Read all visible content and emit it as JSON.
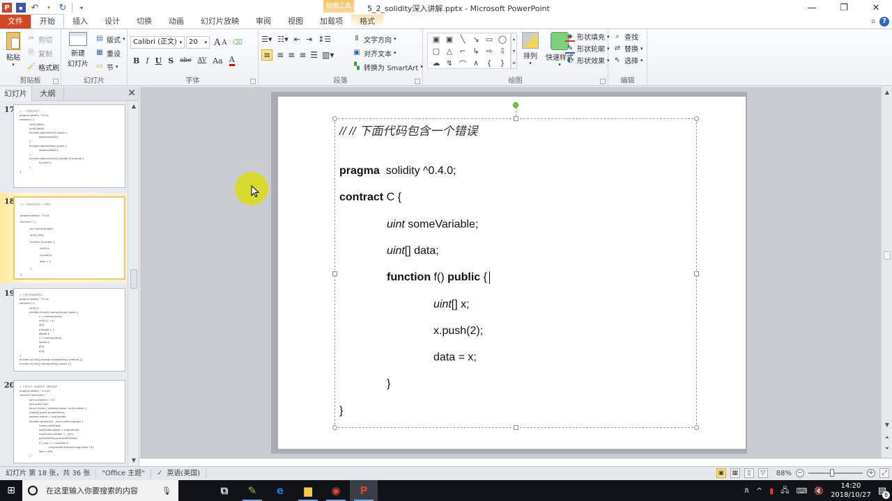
{
  "window": {
    "title": "5_2_solidity深入讲解.pptx - Microsoft PowerPoint",
    "context_tab_group": "绘图工具",
    "controls": {
      "minimize": "—",
      "restore": "❐",
      "close": "✕"
    }
  },
  "quick_access": {
    "app_icon": "P",
    "save_icon": "💾",
    "undo_icon": "↶",
    "redo_icon": "↻",
    "customize_icon": "▾"
  },
  "tabs": [
    {
      "label": "文件",
      "type": "file"
    },
    {
      "label": "开始",
      "type": "active"
    },
    {
      "label": "插入",
      "type": ""
    },
    {
      "label": "设计",
      "type": ""
    },
    {
      "label": "切换",
      "type": ""
    },
    {
      "label": "动画",
      "type": ""
    },
    {
      "label": "幻灯片放映",
      "type": ""
    },
    {
      "label": "审阅",
      "type": ""
    },
    {
      "label": "视图",
      "type": ""
    },
    {
      "label": "加载项",
      "type": ""
    },
    {
      "label": "格式",
      "type": "context"
    }
  ],
  "ribbon": {
    "clipboard": {
      "label": "剪贴板",
      "paste": "粘贴",
      "cut": "剪切",
      "copy": "复制",
      "format_painter": "格式刷"
    },
    "slides": {
      "label": "幻灯片",
      "new_slide_line1": "新建",
      "new_slide_line2": "幻灯片",
      "layout": "版式",
      "reset": "重设",
      "section": "节"
    },
    "font": {
      "label": "字体",
      "font_name": "Calibri (正文)",
      "font_size": "20",
      "grow": "A",
      "shrink": "A",
      "bold": "B",
      "italic": "I",
      "underline": "U",
      "shadow": "S",
      "strikethrough": "abe",
      "spacing": "AV",
      "case": "Aa",
      "color": "A",
      "font_color_hex": "#d00000"
    },
    "paragraph": {
      "label": "段落",
      "text_direction": "文字方向",
      "align_text": "对齐文本",
      "convert_smartart": "转换为 SmartArt"
    },
    "drawing": {
      "label": "绘图",
      "arrange": "排列",
      "quick_styles": "快速样式",
      "shape_fill": "形状填充",
      "shape_outline": "形状轮廓",
      "shape_effects": "形状效果",
      "shapes": [
        "▣",
        "▣",
        "╲",
        "↘",
        "▭",
        "◯",
        "▢",
        "△",
        "⌐",
        "↳",
        "⇨",
        "⇩",
        "☁",
        "↯",
        "⌒",
        "∧",
        "{",
        "}"
      ]
    },
    "editing": {
      "label": "编辑",
      "find": "查找",
      "replace": "替换",
      "select": "选择"
    }
  },
  "left_pane": {
    "tabs": [
      "幻灯片",
      "大纲"
    ],
    "close_icon": "✕",
    "thumbnails": [
      {
        "number": "17",
        "selected": false,
        "lines": [
          {
            "t": "// 一个简单的例子",
            "c": true
          },
          {
            "t": "pragma solidity ^0.4.0;",
            "i": 0
          },
          {
            "t": "contract C {",
            "i": 0
          },
          {
            "t": "uint[] data1;",
            "i": 1
          },
          {
            "t": "uint[] data2;",
            "i": 1
          },
          {
            "t": "function appendOne() public {",
            "i": 1
          },
          {
            "t": "append(data1);",
            "i": 2
          },
          {
            "t": "}",
            "i": 1
          },
          {
            "t": "function appendTwo() public {",
            "i": 1
          },
          {
            "t": "append(data2);",
            "i": 2
          },
          {
            "t": "}",
            "i": 1
          },
          {
            "t": "function append(uint[] storage d) internal {",
            "i": 1
          },
          {
            "t": "d.push(1);",
            "i": 2
          },
          {
            "t": "}",
            "i": 1
          },
          {
            "t": "}",
            "i": 0
          }
        ]
      },
      {
        "number": "18",
        "selected": true,
        "lines": [
          {
            "t": "// // 下面代码包含一个错误",
            "c": true
          },
          {
            "t": "pragma solidity ^0.4.0;",
            "i": 0
          },
          {
            "t": "contract C {",
            "i": 0
          },
          {
            "t": "uint someVariable;",
            "i": 1
          },
          {
            "t": "uint[] data;",
            "i": 1
          },
          {
            "t": "function f() public {",
            "i": 1
          },
          {
            "t": "uint[] x;",
            "i": 2
          },
          {
            "t": "x.push(2);",
            "i": 2
          },
          {
            "t": "data = x;",
            "i": 2
          },
          {
            "t": "}",
            "i": 1
          },
          {
            "t": "}",
            "i": 0
          }
        ]
      },
      {
        "number": "19",
        "selected": false,
        "lines": [
          {
            "t": "// 下面代码编译错误",
            "c": true
          },
          {
            "t": "pragma solidity ^0.4.0;",
            "i": 0
          },
          {
            "t": "contract C {",
            "i": 0
          },
          {
            "t": "uint[] x;",
            "i": 1
          },
          {
            "t": "function f(uint[] memoryArray) public {",
            "i": 1
          },
          {
            "t": "x = memoryArray;",
            "i": 2
          },
          {
            "t": "uint[] y = x;",
            "i": 2
          },
          {
            "t": "y[7];",
            "i": 2
          },
          {
            "t": "y.length = 2;",
            "i": 2
          },
          {
            "t": "delete x;",
            "i": 2
          },
          {
            "t": "y = memoryArray;",
            "i": 2
          },
          {
            "t": "delete y;",
            "i": 2
          },
          {
            "t": "g(x);",
            "i": 2
          },
          {
            "t": "h(x);",
            "i": 2
          },
          {
            "t": "}",
            "i": 0
          },
          {
            "t": "function g(uint[] storage storageArray) internal {}",
            "i": 0
          },
          {
            "t": "function h(uint[] memoryArray) public {}",
            "i": 0
          }
        ]
      },
      {
        "number": "20",
        "selected": false,
        "lines": [
          {
            "t": "// 下面合约一般被称为 \"猜数游戏\"",
            "c": true
          },
          {
            "t": "pragma solidity ^0.4.20;",
            "i": 0
          },
          {
            "t": "contract Honeypot {",
            "i": 0
          },
          {
            "t": "uint luckyNum = 52;",
            "i": 1
          },
          {
            "t": "uint public last;",
            "i": 1
          },
          {
            "t": "struct Guess { address player; uint number; }",
            "i": 1
          },
          {
            "t": "Guess[] public guessHistory;",
            "i": 1
          },
          {
            "t": "address owner = msg.sender;",
            "i": 1
          },
          {
            "t": "function guess(uint _num) public payable {",
            "i": 1
          },
          {
            "t": "Guess newGuess;",
            "i": 2
          },
          {
            "t": "newGuess.player = msg.sender;",
            "i": 2
          },
          {
            "t": "newGuess.number = _num;",
            "i": 2
          },
          {
            "t": "guessHistory.push(newGuess);",
            "i": 2
          },
          {
            "t": "if (_num == luckyNum)",
            "i": 2
          },
          {
            "t": "msg.sender.transfer(msg.value * 2);",
            "i": 3
          },
          {
            "t": "last = now;",
            "i": 2
          },
          {
            "t": "}",
            "i": 1
          }
        ]
      }
    ]
  },
  "slide": {
    "comment": "// // 下面代码包含一个错误",
    "lines": [
      {
        "parts": [
          {
            "t": "pragma",
            "s": "b"
          },
          {
            "t": "  solidity ^0.4.0;",
            "s": ""
          }
        ],
        "indent": 0
      },
      {
        "parts": [
          {
            "t": "contract",
            "s": "b"
          },
          {
            "t": " C {",
            "s": ""
          }
        ],
        "indent": 0
      },
      {
        "parts": [
          {
            "t": "uint",
            "s": "i"
          },
          {
            "t": " someVariable;",
            "s": ""
          }
        ],
        "indent": 1
      },
      {
        "parts": [
          {
            "t": "uint",
            "s": "i"
          },
          {
            "t": "[] data;",
            "s": ""
          }
        ],
        "indent": 1
      },
      {
        "parts": [
          {
            "t": "function",
            "s": "b"
          },
          {
            "t": " f() ",
            "s": ""
          },
          {
            "t": "public",
            "s": "b"
          },
          {
            "t": " {",
            "s": ""
          }
        ],
        "indent": 1,
        "caret": true
      },
      {
        "parts": [
          {
            "t": "uint",
            "s": "i"
          },
          {
            "t": "[] x;",
            "s": ""
          }
        ],
        "indent": 2
      },
      {
        "parts": [
          {
            "t": "x.push(2);",
            "s": ""
          }
        ],
        "indent": 2
      },
      {
        "parts": [
          {
            "t": "data = x;",
            "s": ""
          }
        ],
        "indent": 2
      },
      {
        "parts": [
          {
            "t": "}",
            "s": ""
          }
        ],
        "indent": 1
      },
      {
        "parts": [
          {
            "t": "}",
            "s": ""
          }
        ],
        "indent": 0
      }
    ]
  },
  "statusbar": {
    "slide_info": "幻灯片 第 18 张，共 36 张",
    "theme": "\"Office 主题\"",
    "language": "英语(美国)",
    "zoom": "88%",
    "zoom_fraction": 0.44,
    "minus": "−",
    "plus": "+"
  },
  "taskbar": {
    "search_placeholder": "在这里输入你要搜索的内容",
    "time": "14:20",
    "date": "2018/10/27",
    "notification_count": "8",
    "apps": [
      {
        "name": "task-view",
        "glyph": "⧉",
        "running": false,
        "active": false,
        "color": "#ddd"
      },
      {
        "name": "edit-app",
        "glyph": "✎",
        "running": true,
        "active": false,
        "color": "#8cc152"
      },
      {
        "name": "edge",
        "glyph": "e",
        "running": false,
        "active": false,
        "color": "#1e7ad6"
      },
      {
        "name": "file-explorer",
        "glyph": "▆",
        "running": true,
        "active": false,
        "color": "#f2c94c"
      },
      {
        "name": "chrome",
        "glyph": "◉",
        "running": true,
        "active": false,
        "color": "#e8453c"
      },
      {
        "name": "powerpoint",
        "glyph": "P",
        "running": true,
        "active": true,
        "color": "#d24726"
      }
    ]
  }
}
